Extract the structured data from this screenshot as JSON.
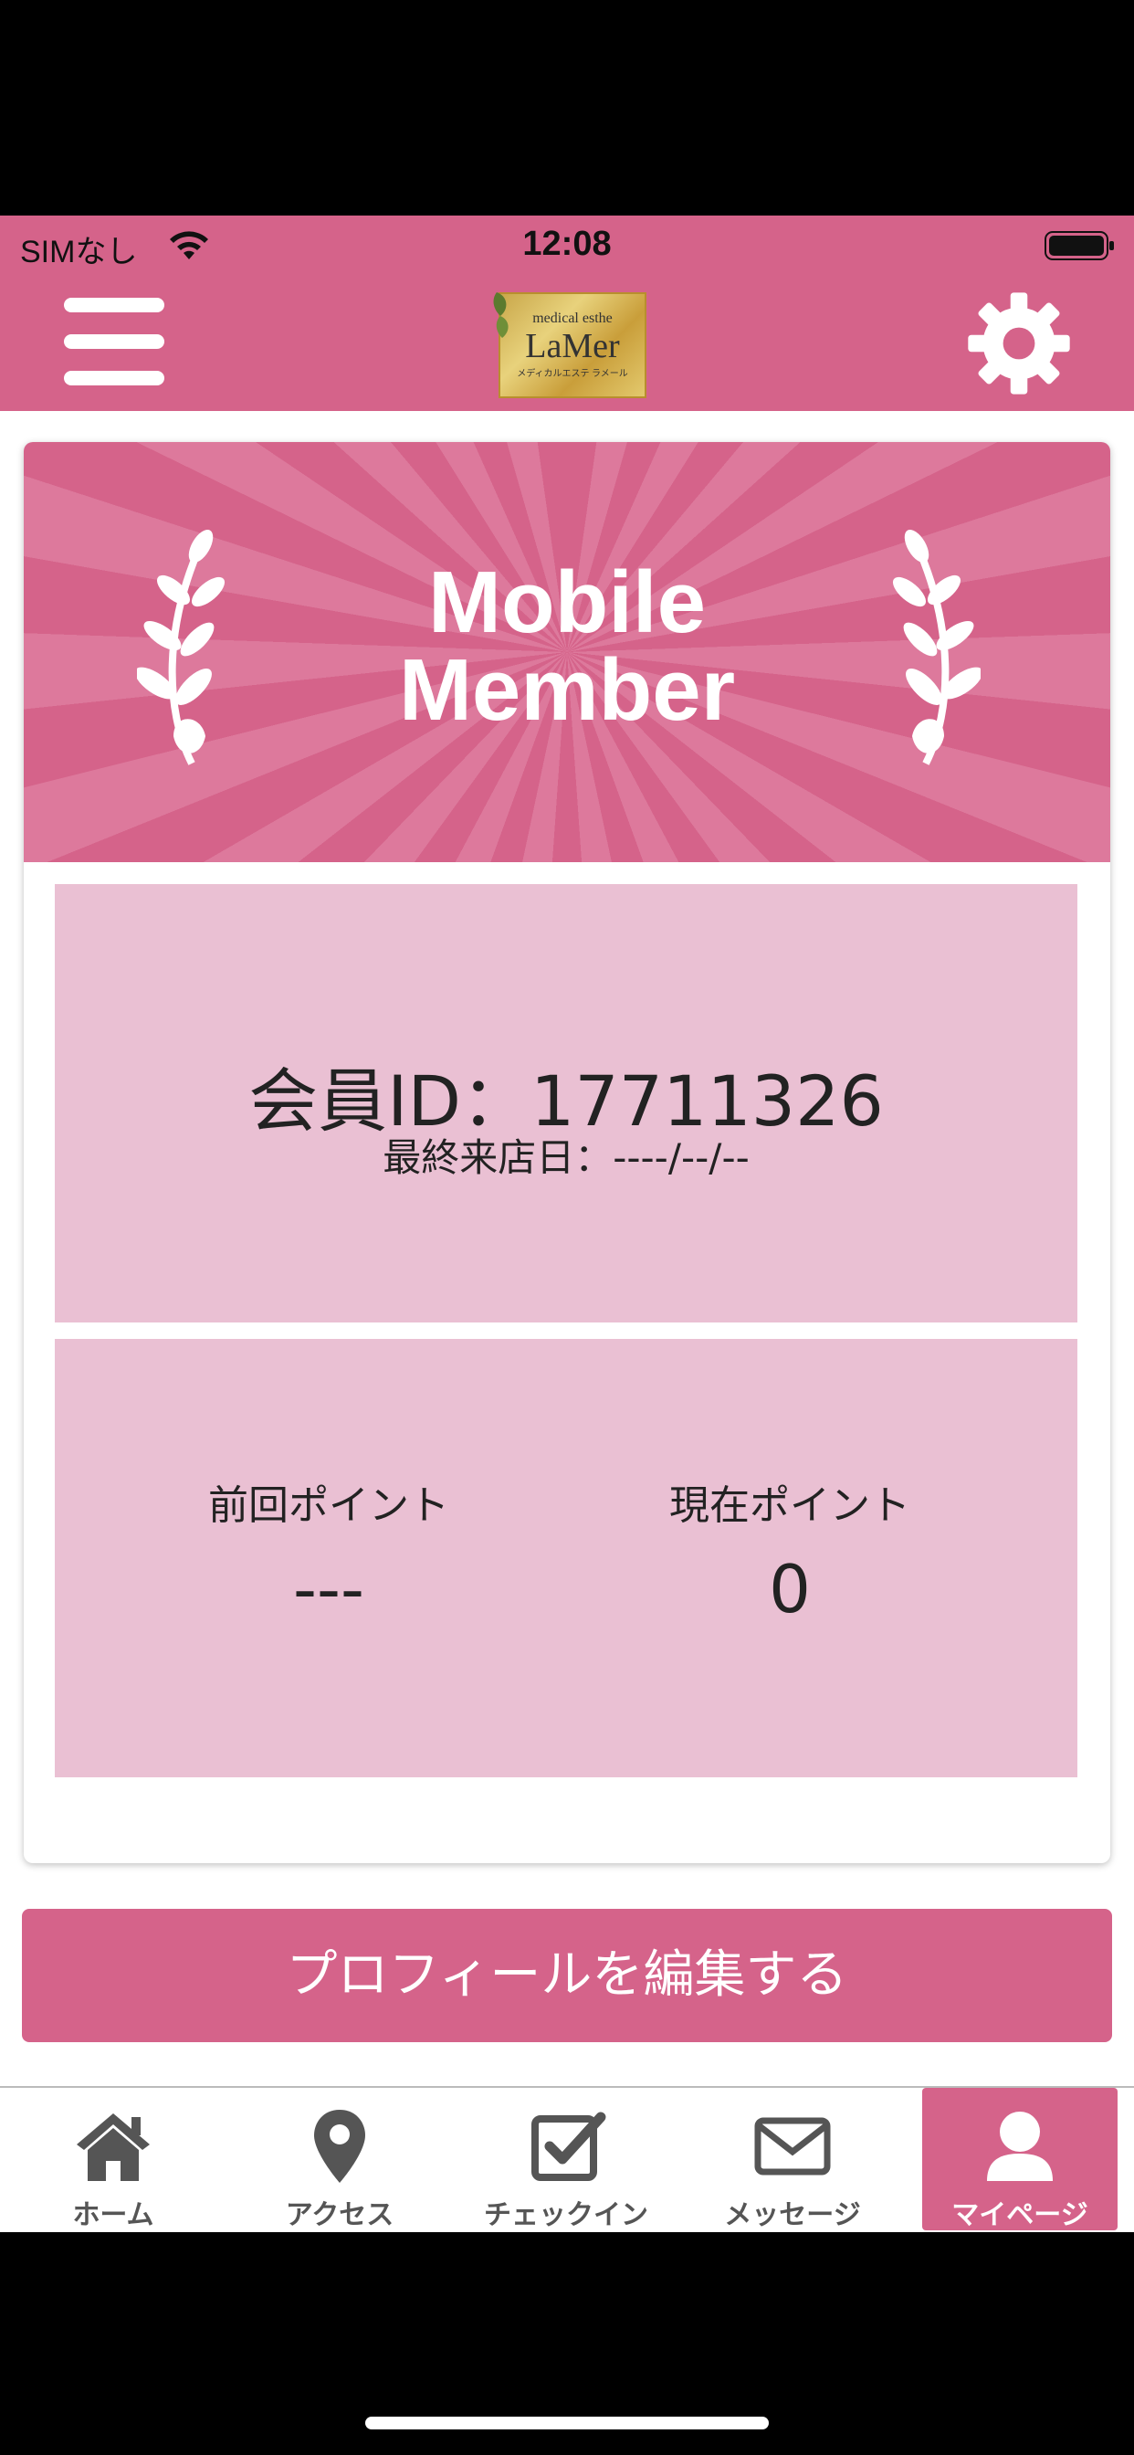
{
  "status_bar": {
    "carrier": "SIMなし",
    "time": "12:08"
  },
  "header": {
    "logo": {
      "line1": "medical esthe",
      "line2": "LaMer",
      "line3": "メディカルエステ ラメール"
    }
  },
  "banner": {
    "title_line1": "Mobile",
    "title_line2": "Member"
  },
  "member": {
    "id_text": "会員ID：17711326",
    "last_visit_text": "最終来店日：----/--/--"
  },
  "points": {
    "previous_label": "前回ポイント",
    "previous_value": "---",
    "current_label": "現在ポイント",
    "current_value": "0"
  },
  "edit_profile_label": "プロフィールを編集する",
  "tabs": [
    {
      "label": "ホーム",
      "icon": "home-icon"
    },
    {
      "label": "アクセス",
      "icon": "map-pin-icon"
    },
    {
      "label": "チェックイン",
      "icon": "checkbox-icon"
    },
    {
      "label": "メッセージ",
      "icon": "envelope-icon"
    },
    {
      "label": "マイページ",
      "icon": "user-icon",
      "active": true
    }
  ],
  "colors": {
    "accent": "#d5638a",
    "panel": "#eac0d3"
  }
}
